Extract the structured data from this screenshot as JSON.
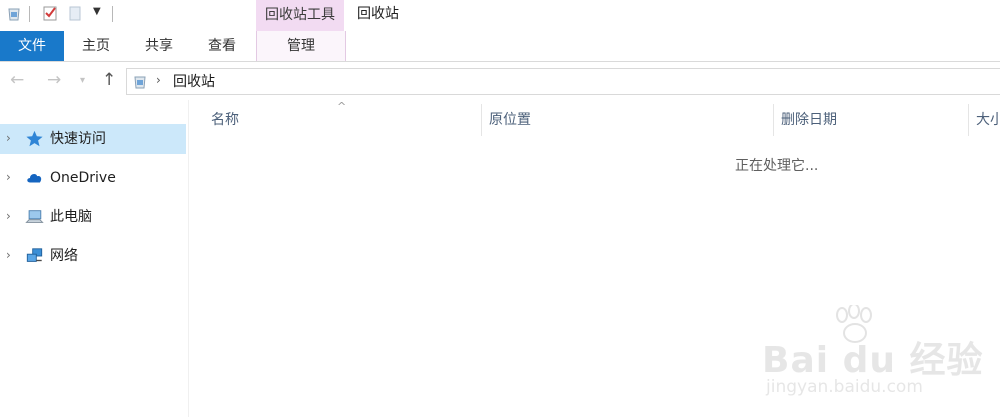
{
  "title_bar": {
    "context_tool_group": "回收站工具",
    "window_title": "回收站"
  },
  "ribbon": {
    "tabs": [
      "文件",
      "主页",
      "共享",
      "查看",
      "管理"
    ]
  },
  "address_bar": {
    "path": "回收站"
  },
  "nav_pane": {
    "items": [
      {
        "label": "快速访问",
        "icon": "star-icon"
      },
      {
        "label": "OneDrive",
        "icon": "cloud-icon"
      },
      {
        "label": "此电脑",
        "icon": "computer-icon"
      },
      {
        "label": "网络",
        "icon": "network-icon"
      }
    ]
  },
  "columns": [
    "名称",
    "原位置",
    "删除日期",
    "大小"
  ],
  "status_text": "正在处理它...",
  "watermark": {
    "line1": "Bai du 经验",
    "line2": "jingyan.baidu.com"
  },
  "colors": {
    "file_tab": "#1979ca",
    "context_tab": "#f2dbf2",
    "selection": "#cce8fa"
  }
}
